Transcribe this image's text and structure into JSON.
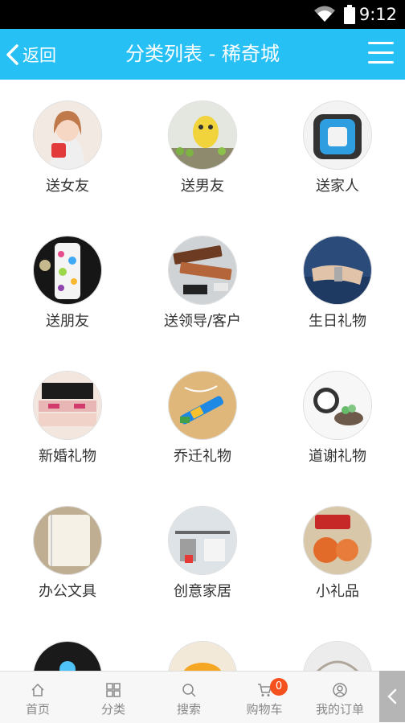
{
  "status_bar": {
    "time": "9:12",
    "icons": [
      "wifi-icon",
      "battery-icon"
    ]
  },
  "header": {
    "back_label": "返回",
    "title": "分类列表 - 稀奇城",
    "menu_icon": "hamburger-icon",
    "color": "#26c0f5"
  },
  "categories": [
    {
      "label": "送女友"
    },
    {
      "label": "送男友"
    },
    {
      "label": "送家人"
    },
    {
      "label": "送朋友"
    },
    {
      "label": "送领导/客户"
    },
    {
      "label": "生日礼物"
    },
    {
      "label": "新婚礼物"
    },
    {
      "label": "乔迁礼物"
    },
    {
      "label": "道谢礼物"
    },
    {
      "label": "办公文具"
    },
    {
      "label": "创意家居"
    },
    {
      "label": "小礼品"
    },
    {
      "label": ""
    },
    {
      "label": ""
    },
    {
      "label": ""
    }
  ],
  "tabbar": {
    "tabs": [
      {
        "label": "首页",
        "icon": "home-icon"
      },
      {
        "label": "分类",
        "icon": "grid-icon"
      },
      {
        "label": "搜索",
        "icon": "search-icon"
      },
      {
        "label": "购物车",
        "icon": "cart-icon",
        "badge": "0"
      },
      {
        "label": "我的订单",
        "icon": "user-icon"
      }
    ],
    "badge_color": "#f5511e"
  }
}
